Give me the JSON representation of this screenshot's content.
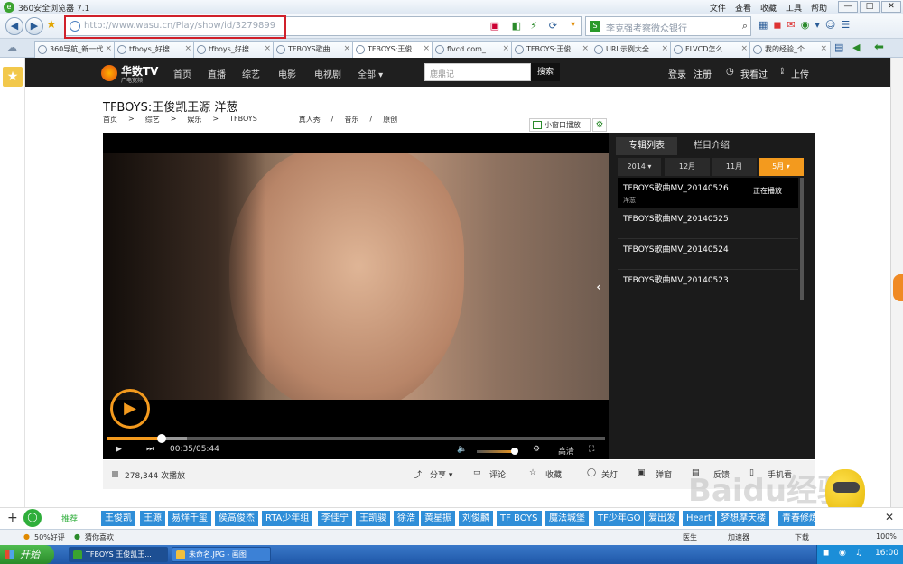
{
  "window": {
    "title": "360安全浏览器 7.1",
    "menus": [
      "文件",
      "查看",
      "收藏",
      "工具",
      "帮助"
    ],
    "controls": [
      "—",
      "□",
      "✕"
    ]
  },
  "address": {
    "url": "http://www.wasu.cn/Play/show/id/3279899",
    "search_value": "李克强考察微众银行"
  },
  "tabs": [
    {
      "label": "360导航_新一代"
    },
    {
      "label": "tfboys_好搜"
    },
    {
      "label": "tfboys_好搜"
    },
    {
      "label": "TFBOYS歌曲"
    },
    {
      "label": "TFBOYS:王俊"
    },
    {
      "label": "flvcd.com_"
    },
    {
      "label": "TFBOYS:王俊"
    },
    {
      "label": "URL示例大全"
    },
    {
      "label": "FLVCD怎么"
    },
    {
      "label": "我的经验_个"
    }
  ],
  "site": {
    "logo_name": "华数TV",
    "logo_sub": "广电宽频",
    "nav": [
      "首页",
      "直播",
      "综艺",
      "电影",
      "电视剧",
      "全部 ▾"
    ],
    "search_placeholder": "鹿鼎记",
    "search_button": "搜索",
    "login": "登录",
    "register": "注册",
    "history": "我看过",
    "upload": "上传"
  },
  "page": {
    "title": "TFBOYS:王俊凯王源 洋葱",
    "breadcrumb": [
      "首页",
      ">",
      "综艺",
      ">",
      "娱乐",
      ">",
      "TFBOYS"
    ],
    "tags": [
      "真人秀",
      "/",
      "音乐",
      "/",
      "原创"
    ],
    "mini_player": "小窗口播放"
  },
  "player": {
    "time": "00:35/05:44",
    "quality": "高清",
    "progress": 0.11
  },
  "panel": {
    "tabs": [
      "专辑列表",
      "栏目介绍"
    ],
    "years": [
      "2014 ▾",
      "12月",
      "11月",
      "5月 ▾"
    ],
    "episodes": [
      {
        "title": "TFBOYS歌曲MV_20140526",
        "sub": "洋葱",
        "status": "正在播放"
      },
      {
        "title": "TFBOYS歌曲MV_20140525"
      },
      {
        "title": "TFBOYS歌曲MV_20140524"
      },
      {
        "title": "TFBOYS歌曲MV_20140523"
      }
    ]
  },
  "stats": {
    "play_count": "278,344 次播放",
    "actions": [
      "分享 ▾",
      "评论",
      "收藏",
      "关灯",
      "弹窗",
      "反馈",
      "手机看"
    ]
  },
  "watermark": "Baidu经验",
  "tagbar": {
    "rec": "推荐",
    "tags": [
      "王俊凯",
      "王源",
      "易烊千玺",
      "侯高俊杰",
      "RTA少年组",
      "李佳宁",
      "王凯骏",
      "徐浩",
      "黄星振",
      "刘俊麟",
      "TF BOYS",
      "魔法城堡",
      "TF少年GO",
      "爱出发",
      "Heart",
      "梦想摩天楼",
      "青春修炼手册"
    ]
  },
  "status": {
    "left": "50%好评",
    "guess": "猜你喜欢",
    "right": [
      "医生",
      "加速器",
      "下载",
      "100%"
    ]
  },
  "taskbar": {
    "start": "开始",
    "tasks": [
      "TFBOYS 王俊凯王...",
      "未命名.JPG - 画图"
    ],
    "clock": "16:00"
  }
}
